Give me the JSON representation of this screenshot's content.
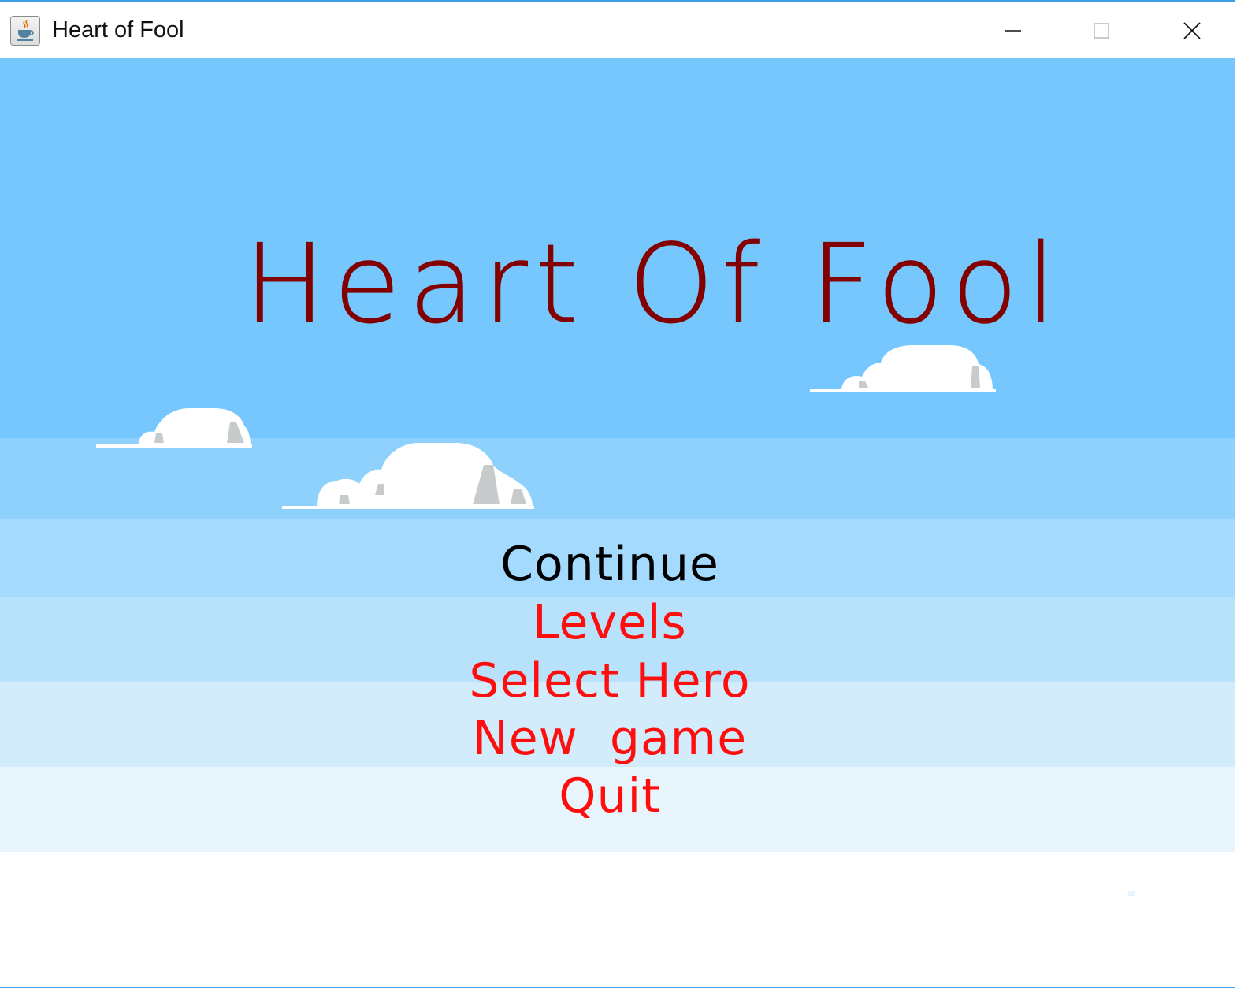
{
  "window": {
    "title": "Heart of Fool",
    "icon": "java-coffee-cup-icon",
    "controls": [
      "minimize-icon",
      "maximize-icon",
      "close-icon"
    ]
  },
  "game": {
    "title": "Heart Of Fool",
    "title_color": "#830000",
    "menu": {
      "items": [
        {
          "label": "Continue",
          "selected": true
        },
        {
          "label": "Levels",
          "selected": false
        },
        {
          "label": "Select Hero",
          "selected": false
        },
        {
          "label": "New  game",
          "selected": false
        },
        {
          "label": "Quit",
          "selected": false
        }
      ],
      "selected_color": "#000000",
      "item_color": "#ff0e0e"
    },
    "sky_colors": [
      "#75c7fd",
      "#8fd1fd",
      "#a4dafd",
      "#b8e2fb",
      "#d2ecfc",
      "#e8f5fd",
      "#ffffff"
    ]
  }
}
